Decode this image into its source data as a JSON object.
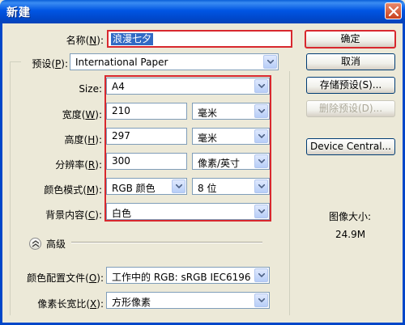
{
  "window": {
    "title": "新建"
  },
  "fields": {
    "name": {
      "label": "名称",
      "hotkey": "N",
      "value": "浪漫七夕"
    },
    "preset": {
      "label": "预设",
      "hotkey": "P",
      "value": "International Paper"
    },
    "size": {
      "label": "Size:",
      "value": "A4"
    },
    "width": {
      "label": "宽度",
      "hotkey": "W",
      "value": "210",
      "unit": "毫米"
    },
    "height": {
      "label": "高度",
      "hotkey": "H",
      "value": "297",
      "unit": "毫米"
    },
    "resolution": {
      "label": "分辨率",
      "hotkey": "R",
      "value": "300",
      "unit": "像素/英寸"
    },
    "color_mode": {
      "label": "颜色模式",
      "hotkey": "M",
      "value": "RGB 颜色",
      "bits": "8 位"
    },
    "background": {
      "label": "背景内容",
      "hotkey": "C",
      "value": "白色"
    },
    "color_profile": {
      "label": "颜色配置文件",
      "hotkey": "O",
      "value": "工作中的 RGB: sRGB IEC6196..."
    },
    "pixel_aspect": {
      "label": "像素长宽比",
      "hotkey": "X",
      "value": "方形像素"
    }
  },
  "advanced": {
    "label": "高级"
  },
  "buttons": {
    "ok": "确定",
    "cancel": "取消",
    "save_preset": "存储预设(S)...",
    "delete_preset": "删除预设(D)...",
    "device_central": "Device Central..."
  },
  "image_size": {
    "label": "图像大小:",
    "value": "24.9M"
  }
}
